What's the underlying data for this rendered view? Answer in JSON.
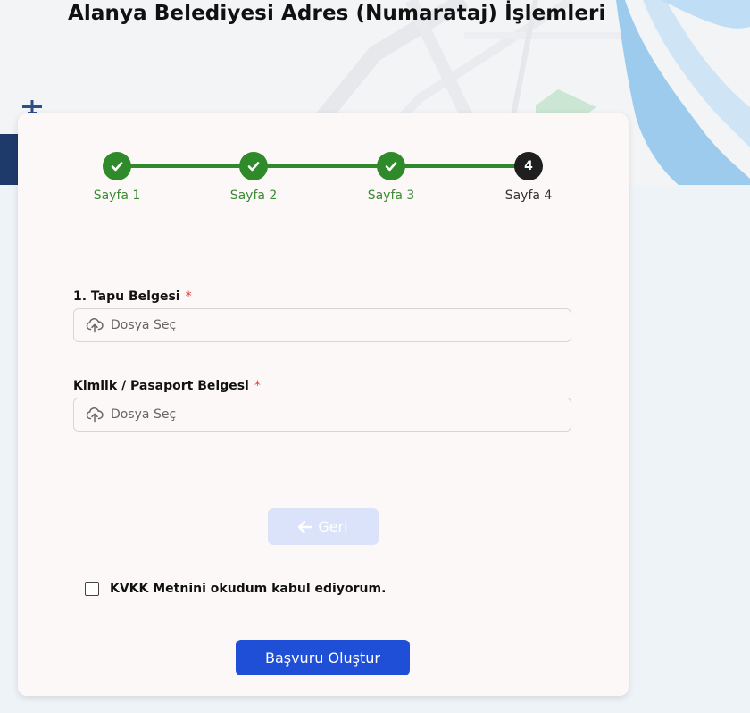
{
  "header": {
    "title": "Alanya Belediyesi Adres (Numarataj) İşlemleri"
  },
  "stepper": {
    "steps": [
      {
        "label": "Sayfa 1",
        "status": "completed",
        "icon": "check-icon"
      },
      {
        "label": "Sayfa 2",
        "status": "completed",
        "icon": "check-icon"
      },
      {
        "label": "Sayfa 3",
        "status": "completed",
        "icon": "check-icon"
      },
      {
        "label": "Sayfa 4",
        "status": "current",
        "number": "4"
      }
    ],
    "completed_color": "#2f8a2a",
    "current_color": "#1f1f1f"
  },
  "form": {
    "fields": [
      {
        "label": "1. Tapu Belgesi",
        "required_mark": "*",
        "placeholder": "Dosya Seç",
        "icon": "cloud-upload-icon"
      },
      {
        "label": "Kimlik / Pasaport Belgesi",
        "required_mark": "*",
        "placeholder": "Dosya Seç",
        "icon": "cloud-upload-icon"
      }
    ],
    "back_button": {
      "label": "Geri",
      "icon": "arrow-left-icon",
      "disabled": true
    },
    "kvkk": {
      "label": "KVKK Metnini okudum kabul ediyorum.",
      "checked": false
    },
    "submit_button": {
      "label": "Başvuru Oluştur"
    }
  },
  "colors": {
    "primary": "#1f4fd6",
    "success": "#2f8a2a",
    "required": "#e03a3a",
    "card_background": "#fdf8f8"
  }
}
